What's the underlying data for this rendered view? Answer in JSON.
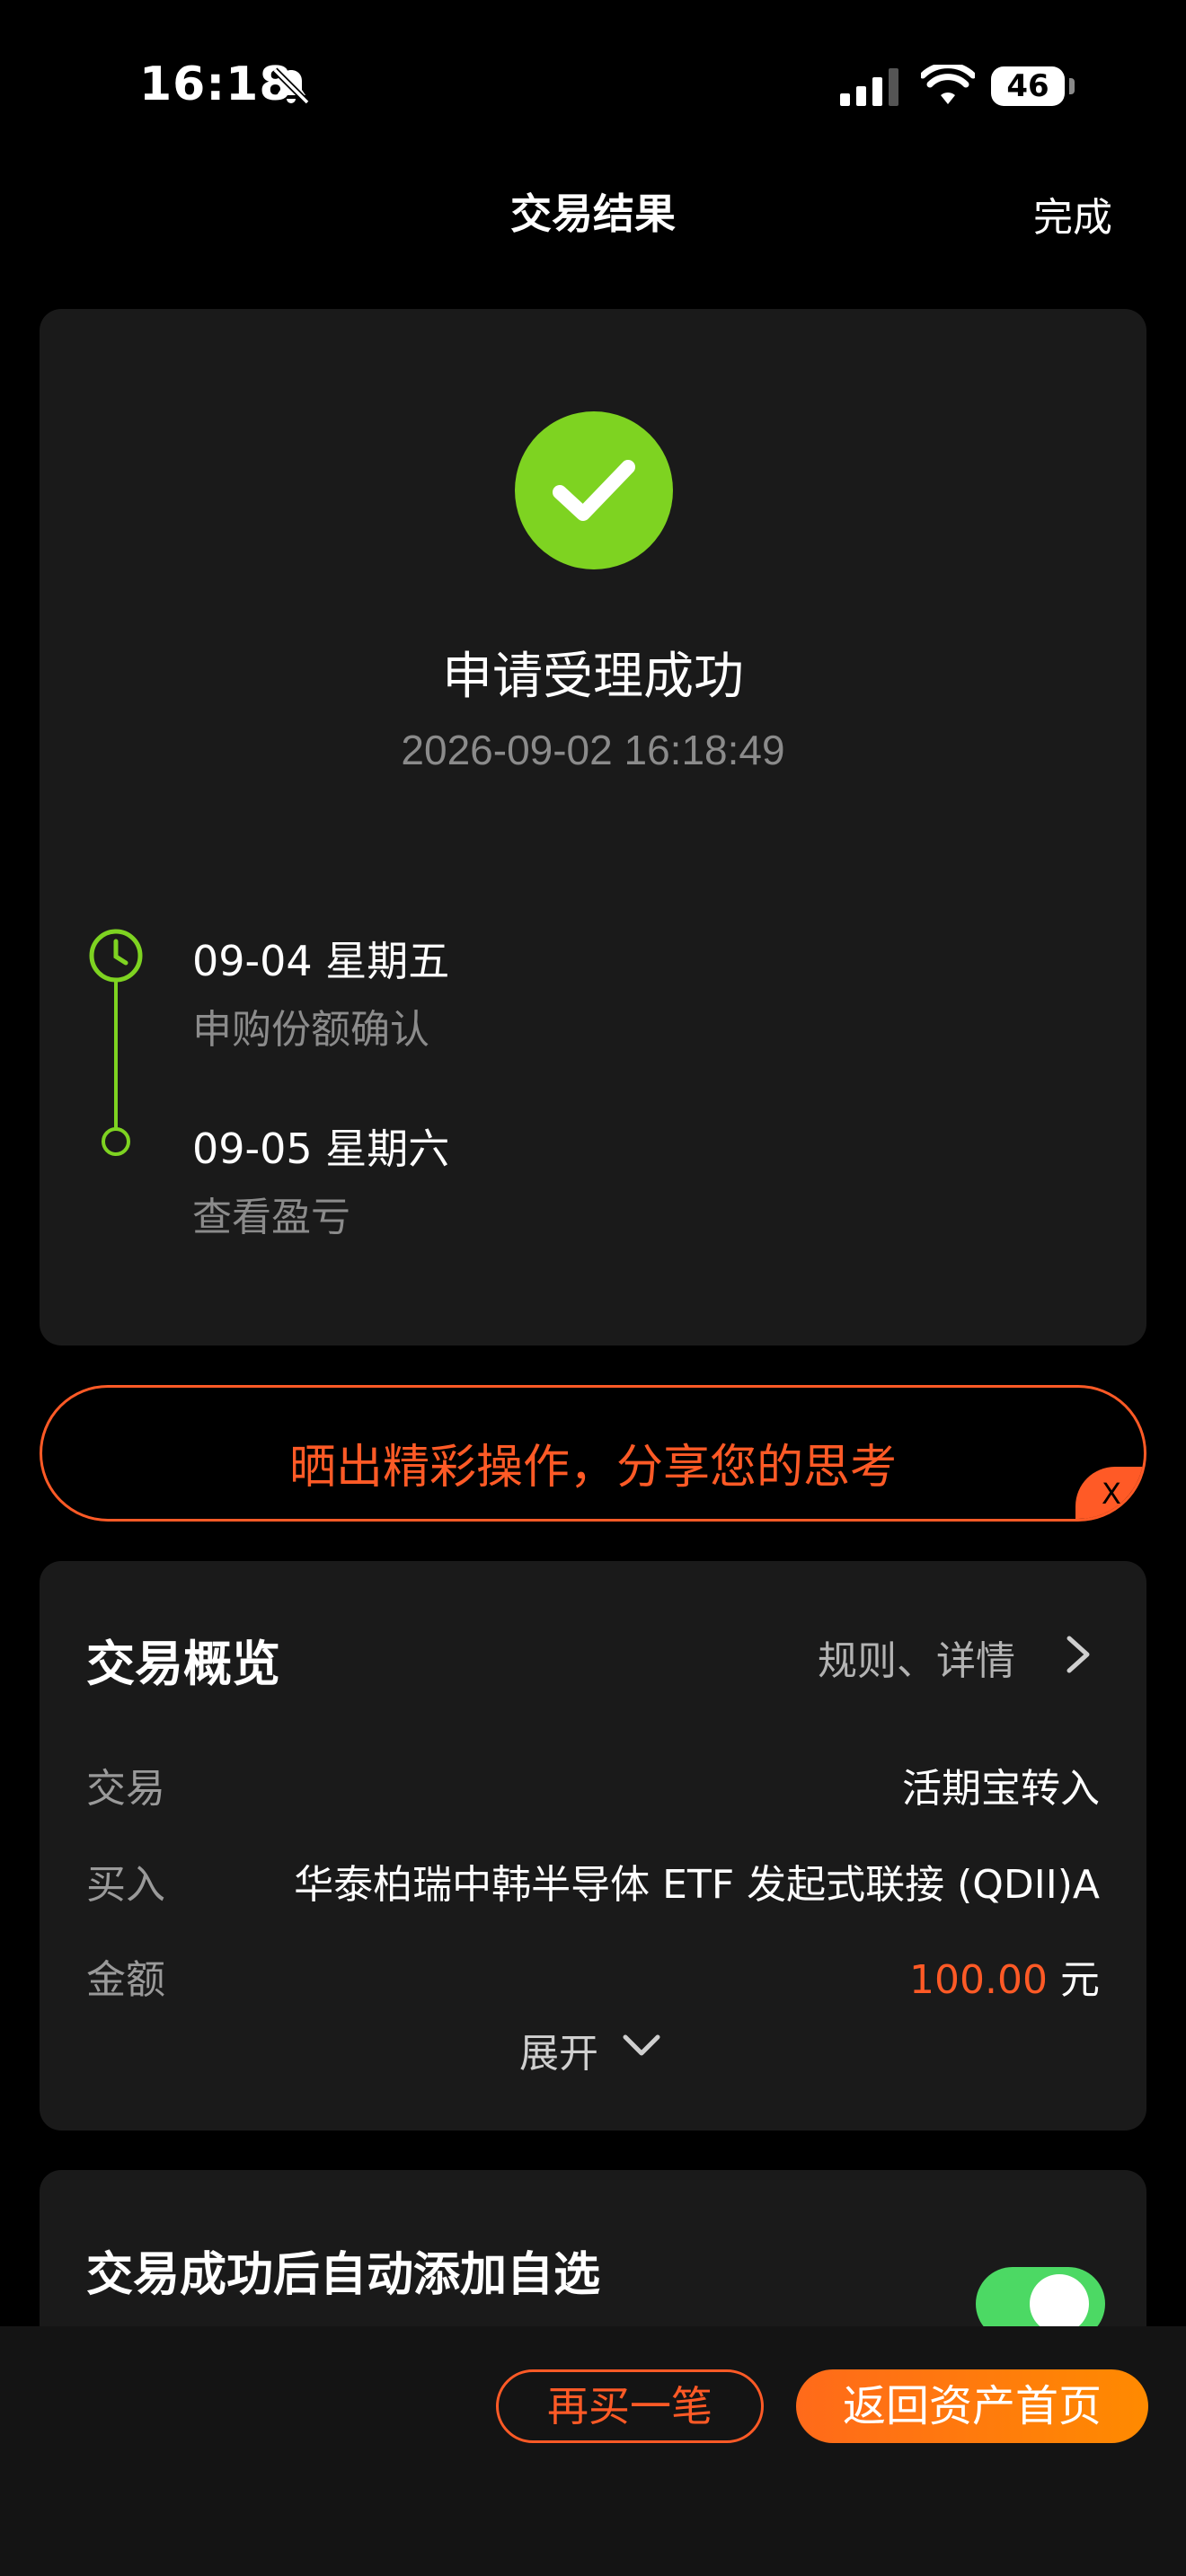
{
  "status_bar": {
    "time": "16:18",
    "battery": "46",
    "icons": [
      "bell-slash-icon",
      "signal-icon",
      "wifi-icon",
      "battery-icon"
    ]
  },
  "nav": {
    "title": "交易结果",
    "done_label": "完成"
  },
  "result": {
    "icon": "check-icon",
    "title": "申请受理成功",
    "time": "2026-09-02 16:18:49",
    "timeline": [
      {
        "date": "09-04  星期五",
        "desc": "申购份额确认",
        "icon": "clock-icon"
      },
      {
        "date": "09-05  星期六",
        "desc": "查看盈亏",
        "icon": "dot-icon"
      }
    ]
  },
  "share_banner": {
    "text": "晒出精彩操作，分享您的思考",
    "close_label": "X"
  },
  "overview": {
    "title": "交易概览",
    "link_label": "规则、详情",
    "rows": [
      {
        "label": "交易",
        "value": "活期宝转入"
      },
      {
        "label": "买入",
        "value": "华泰柏瑞中韩半导体 ETF 发起式联接 (QDII)A"
      },
      {
        "label": "金额",
        "amount": "100.00",
        "unit": "元"
      }
    ],
    "expand_label": "展开"
  },
  "auto_add": {
    "title": "交易成功后自动添加自选",
    "toggle_on": true
  },
  "bottom_bar": {
    "rebuy_label": "再买一笔",
    "home_label": "返回资产首页"
  },
  "colors": {
    "accent": "#ff5a26",
    "success": "#7ed321",
    "toggle": "#4cd964",
    "card_bg": "#1a1a1a"
  }
}
